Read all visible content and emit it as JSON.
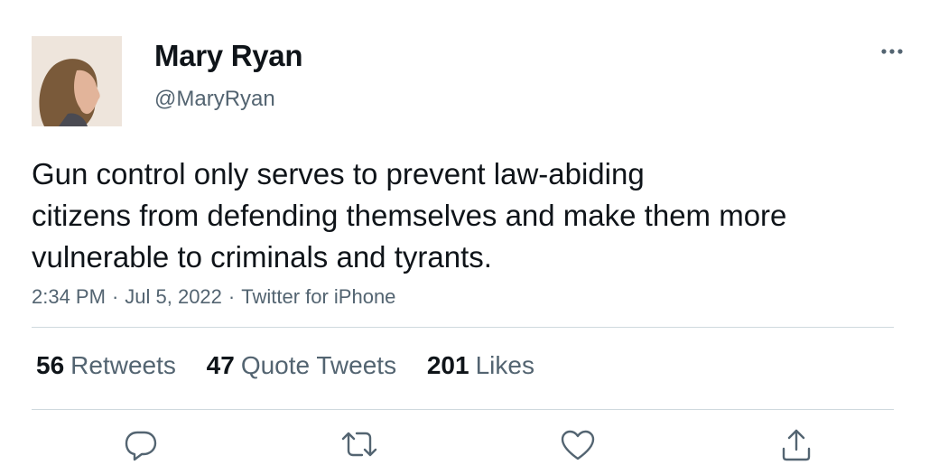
{
  "tweet": {
    "author": {
      "display_name": "Mary Ryan",
      "handle": "@MaryRyan"
    },
    "text_lines": [
      "Gun control only serves to prevent law-abiding",
      "citizens from defending themselves and make them more",
      "vulnerable to criminals and tyrants."
    ],
    "time": "2:34 PM",
    "date": "Jul 5, 2022",
    "source": "Twitter for iPhone",
    "separator": "·"
  },
  "stats": {
    "retweets": {
      "count": "56",
      "label": "Retweets"
    },
    "quotes": {
      "count": "47",
      "label": "Quote Tweets"
    },
    "likes": {
      "count": "201",
      "label": "Likes"
    }
  },
  "actions": [
    "reply-icon",
    "retweet-icon",
    "like-icon",
    "share-icon"
  ],
  "colors": {
    "text": "#0f1419",
    "secondary": "#536471",
    "divider": "#cfd9de"
  }
}
